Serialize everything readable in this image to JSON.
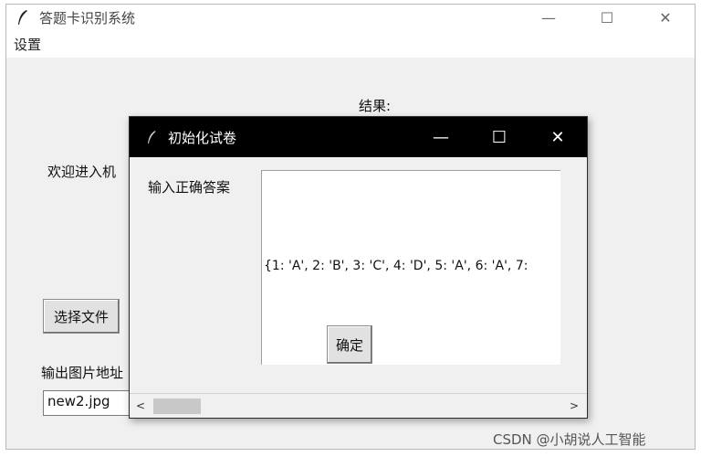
{
  "window": {
    "title": "答题卡识别系统",
    "controls": {
      "minimize": "—",
      "maximize": "☐",
      "close": "✕"
    }
  },
  "menu": {
    "items": [
      {
        "label": "设置"
      }
    ]
  },
  "main": {
    "result_label": "结果:",
    "welcome_text": "欢迎进入机",
    "choose_file_button": "选择文件",
    "output_path_label": "输出图片地址",
    "output_path_value": "new2.jpg"
  },
  "dialog": {
    "title": "初始化试卷",
    "controls": {
      "minimize": "—",
      "maximize": "☐",
      "close": "✕"
    },
    "answer_label": "输入正确答案",
    "answer_value": "{1: 'A', 2: 'B', 3: 'C', 4: 'D', 5: 'A', 6: 'A', 7:",
    "confirm_button": "确定",
    "scroll_left": "<",
    "scroll_right": ">"
  },
  "watermark": "CSDN @小胡说人工智能",
  "icons": {
    "app": "feather-icon",
    "dialog": "feather-icon"
  }
}
